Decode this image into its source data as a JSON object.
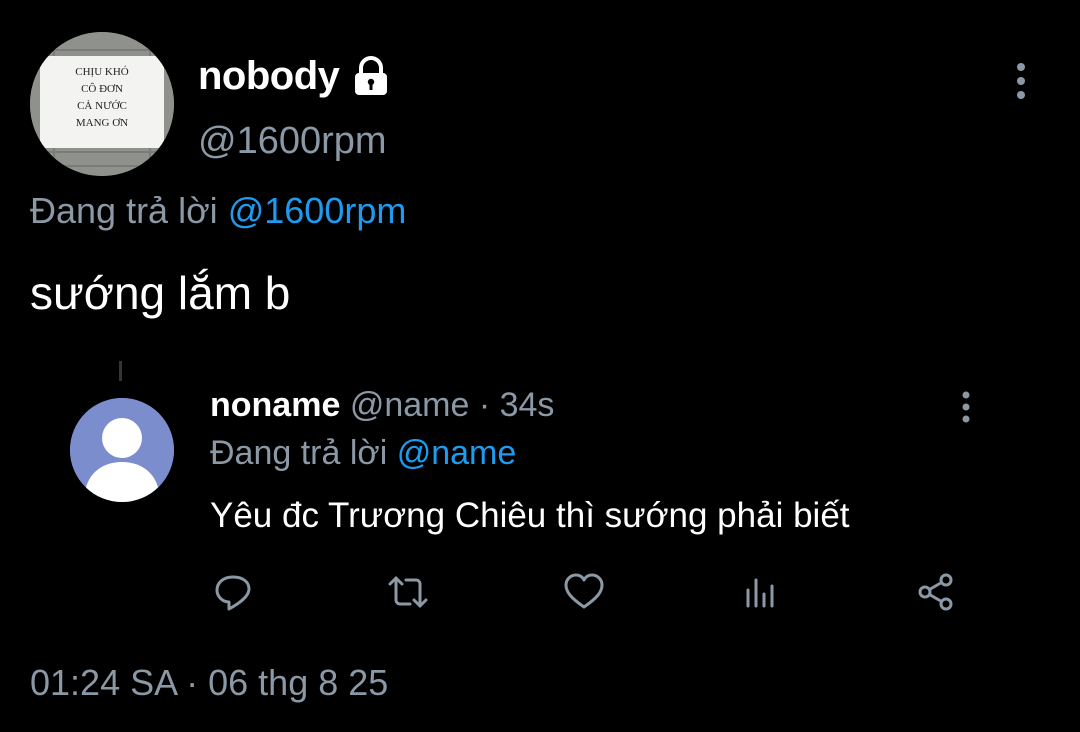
{
  "main_tweet": {
    "author_name": "nobody",
    "author_handle": "@1600rpm",
    "replying_prefix": "Đang trả lời",
    "replying_to": "@1600rpm",
    "text": "sướng lắm b",
    "avatar_sign_lines": [
      "CHỊU KHÓ",
      "CÔ ĐƠN",
      "CẢ NƯỚC",
      "MANG ƠN"
    ],
    "timestamp": "01:24 SA · 06 thg 8 25",
    "icons": {
      "protected": "lock-icon",
      "more": "more-vertical-icon"
    }
  },
  "reply_tweet": {
    "author_name": "noname",
    "author_handle": "@name",
    "separator": " · ",
    "time_ago": "34s",
    "replying_prefix": "Đang trả lời",
    "replying_to": "@name",
    "text": "Yêu đc Trương Chiêu thì sướng phải biết",
    "actions": [
      "reply-icon",
      "retweet-icon",
      "like-icon",
      "views-icon",
      "share-icon"
    ]
  },
  "colors": {
    "background": "#000000",
    "text_primary": "#ffffff",
    "text_secondary": "#8b98a5",
    "accent": "#1d9bf0",
    "default_avatar_bg": "#7b8dcd"
  }
}
